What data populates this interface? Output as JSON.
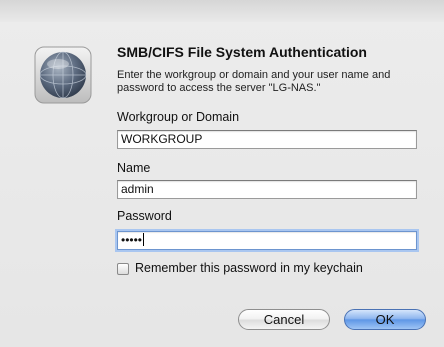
{
  "dialog": {
    "title": "SMB/CIFS File System Authentication",
    "message": "Enter the workgroup or domain and your user name and password to access the server \"LG-NAS.\"",
    "icon": "network-server-globe-icon"
  },
  "fields": {
    "workgroup": {
      "label": "Workgroup or Domain",
      "value": "WORKGROUP"
    },
    "name": {
      "label": "Name",
      "value": "admin"
    },
    "password": {
      "label": "Password",
      "masked_value": "•••••"
    }
  },
  "remember": {
    "label": "Remember this password in my keychain",
    "checked": false
  },
  "buttons": {
    "cancel": "Cancel",
    "ok": "OK"
  },
  "colors": {
    "default_button": "#6a9ee8",
    "focus_ring": "#a9c6f0",
    "dialog_bg": "#e8e8e8"
  }
}
